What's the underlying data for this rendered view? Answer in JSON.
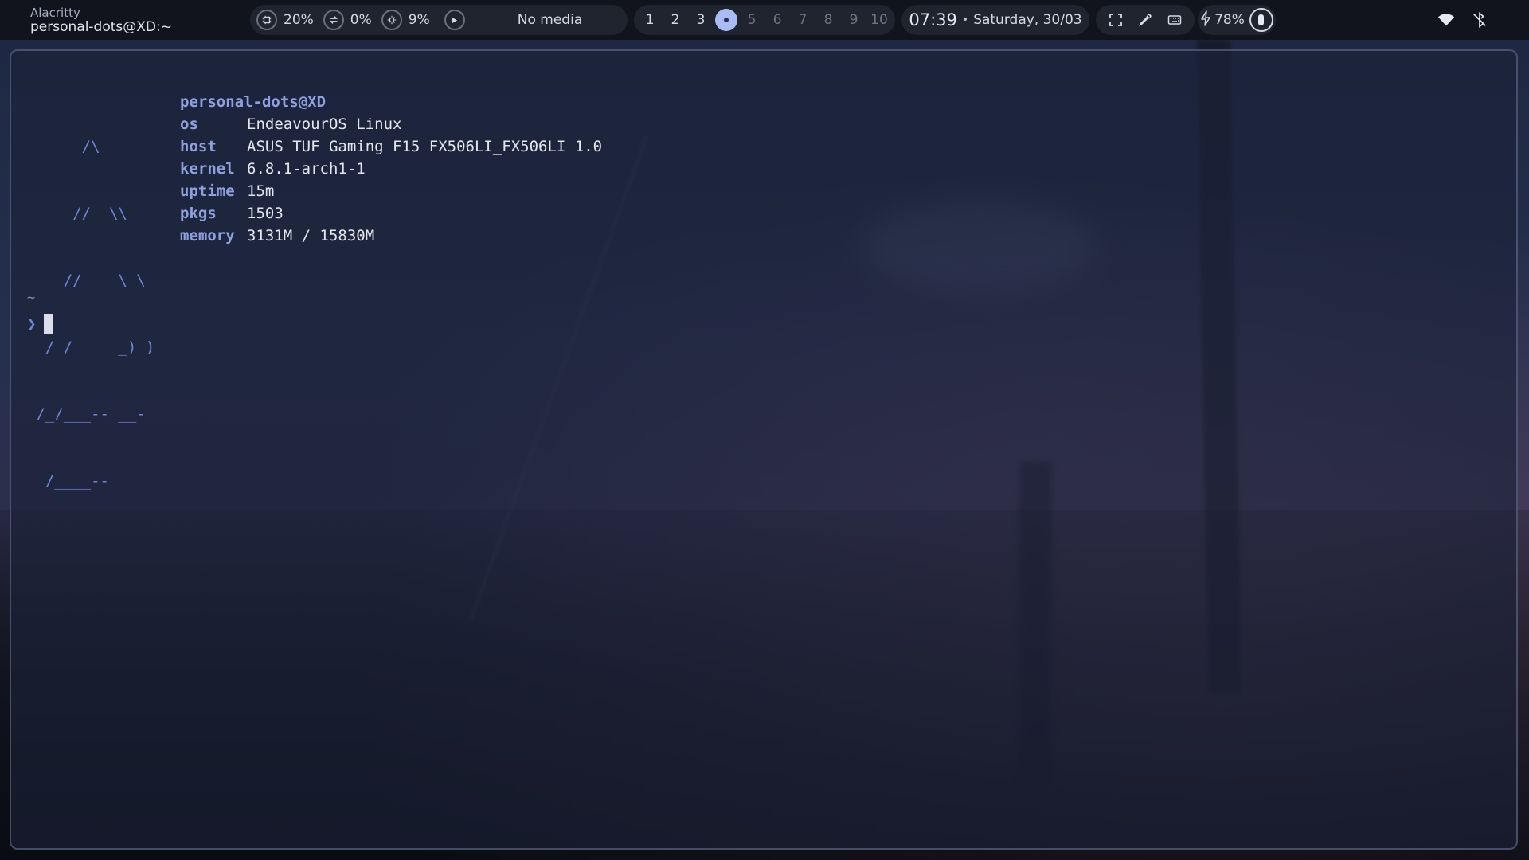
{
  "window": {
    "class": "Alacritty",
    "title": "personal-dots@XD:~"
  },
  "resources": [
    {
      "icon": "cpu-icon",
      "value": "20%"
    },
    {
      "icon": "swap-icon",
      "value": "0%"
    },
    {
      "icon": "memory-icon",
      "value": "9%"
    }
  ],
  "media": {
    "play_icon": "play-icon",
    "text": "No media"
  },
  "workspaces": [
    {
      "label": "1",
      "state": "occupied"
    },
    {
      "label": "2",
      "state": "occupied"
    },
    {
      "label": "3",
      "state": "occupied"
    },
    {
      "label": "",
      "state": "active"
    },
    {
      "label": "5",
      "state": "empty"
    },
    {
      "label": "6",
      "state": "empty"
    },
    {
      "label": "7",
      "state": "empty"
    },
    {
      "label": "8",
      "state": "empty"
    },
    {
      "label": "9",
      "state": "empty"
    },
    {
      "label": "10",
      "state": "empty"
    }
  ],
  "clock": {
    "time": "07:39",
    "separator": "•",
    "date": "Saturday, 30/03"
  },
  "tools": [
    "fullscreen-icon",
    "color-picker-icon",
    "keyboard-icon"
  ],
  "battery": {
    "icon": "bolt-icon",
    "percent": "78%",
    "level": 0.78
  },
  "tray": [
    "wifi-icon",
    "bluetooth-off-icon"
  ],
  "terminal": {
    "logo_lines": [
      "      /\\",
      "     //  \\\\",
      "    //    \\ \\",
      "  / /     _) )",
      " /_/___-- __-",
      "  /____--"
    ],
    "user_host": "personal-dots@XD",
    "info": [
      {
        "key": "os",
        "value": "EndeavourOS Linux"
      },
      {
        "key": "host",
        "value": "ASUS TUF Gaming F15 FX506LI_FX506LI 1.0"
      },
      {
        "key": "kernel",
        "value": "6.8.1-arch1-1"
      },
      {
        "key": "uptime",
        "value": "15m"
      },
      {
        "key": "pkgs",
        "value": "1503"
      },
      {
        "key": "memory",
        "value": "3131M / 15830M"
      }
    ],
    "cwd": "~",
    "prompt_symbol": "❯"
  },
  "colors": {
    "accent": "#a9bcf5",
    "bar_bg": "#12141c",
    "term_key": "#8fa0de",
    "logo": "#6e85d8"
  }
}
